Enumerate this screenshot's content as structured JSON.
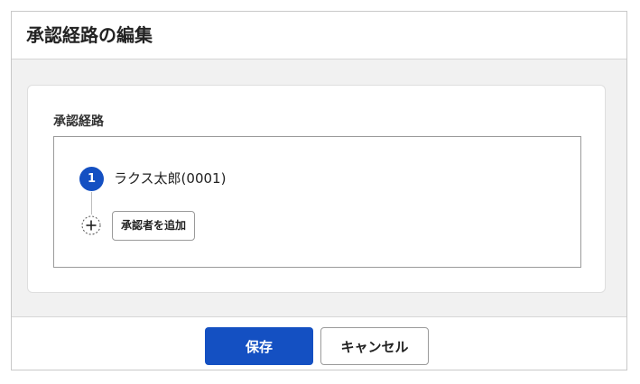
{
  "dialog": {
    "title": "承認経路の編集"
  },
  "route": {
    "label": "承認経路",
    "steps": [
      {
        "number": "1",
        "name": "ラクス太郎(0001)"
      }
    ],
    "add_icon": "plus-circle-icon",
    "add_button_label": "承認者を追加"
  },
  "footer": {
    "save_label": "保存",
    "cancel_label": "キャンセル"
  },
  "colors": {
    "primary": "#1450c2",
    "background": "#f1f1f1",
    "border": "#9a9a9a"
  }
}
